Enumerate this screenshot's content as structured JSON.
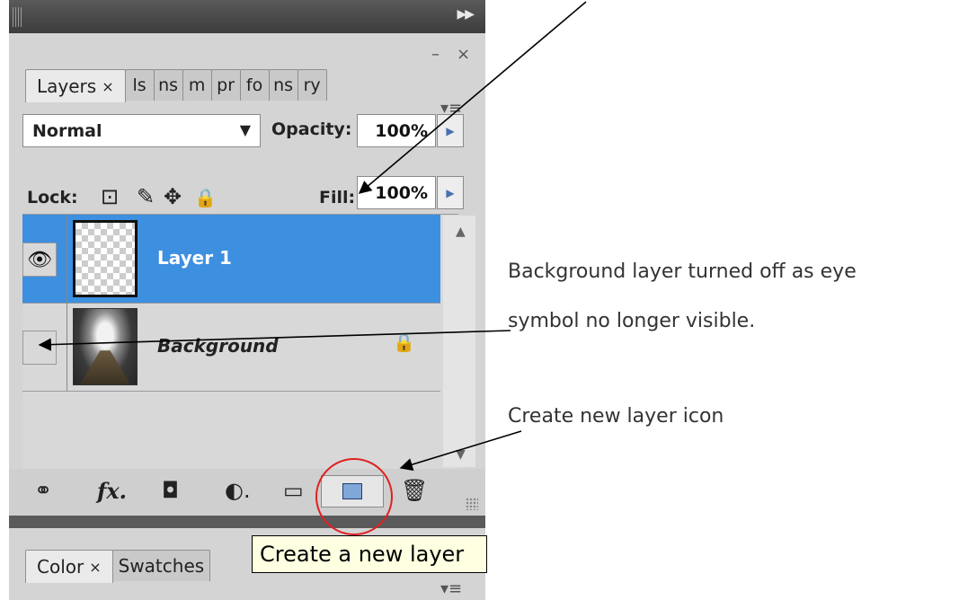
{
  "panel": {
    "collapse_glyph": "▶▶",
    "minimize_glyph": "–",
    "close_glyph": "×",
    "tabs": [
      {
        "label": "Layers",
        "close": "×"
      },
      {
        "label": "ls"
      },
      {
        "label": "ns"
      },
      {
        "label": "m"
      },
      {
        "label": "pr"
      },
      {
        "label": "fo"
      },
      {
        "label": "ns"
      },
      {
        "label": "ry"
      }
    ],
    "menu_glyph": "▾≡"
  },
  "blend_mode": {
    "value": "Normal",
    "arrow": "▼"
  },
  "opacity": {
    "label": "Opacity:",
    "value": "100%",
    "stepper": "▶"
  },
  "lock": {
    "label": "Lock:",
    "icons": [
      "lock-transparent-icon",
      "lock-brush-icon",
      "lock-move-icon",
      "lock-all-icon"
    ],
    "glyphs": [
      "⊡",
      "✎",
      "✥",
      "🔒"
    ]
  },
  "fill": {
    "label": "Fill:",
    "value": "100%",
    "stepper": "▶"
  },
  "layers": [
    {
      "name": "Layer 1",
      "visible": true,
      "selected": true,
      "eye_glyph": "👁"
    },
    {
      "name": "Background",
      "visible": false,
      "selected": false,
      "lock_glyph": "🔒"
    }
  ],
  "scroll": {
    "up": "▲",
    "down": "▼"
  },
  "bottom_icons": [
    {
      "name": "link-icon",
      "glyph": "⚭"
    },
    {
      "name": "fx-icon",
      "glyph": "fx."
    },
    {
      "name": "mask-icon",
      "glyph": "◘"
    },
    {
      "name": "adjustment-icon",
      "glyph": "◐."
    },
    {
      "name": "folder-icon",
      "glyph": "▭"
    },
    {
      "name": "trash-icon",
      "glyph": "🗑"
    }
  ],
  "panel2": {
    "tabs": [
      {
        "label": "Color",
        "close": "×"
      },
      {
        "label": "Swatches"
      }
    ],
    "menu_glyph": "▾≡"
  },
  "tooltip": "Create a new layer",
  "annotations": {
    "background_off_line1": "Background layer turned off as eye",
    "background_off_line2": "symbol no longer visible.",
    "new_layer": "Create new layer icon"
  },
  "colors": {
    "selection": "#3d8fe0",
    "tooltip_bg": "#ffffe1",
    "highlight_circle": "#e02020"
  }
}
